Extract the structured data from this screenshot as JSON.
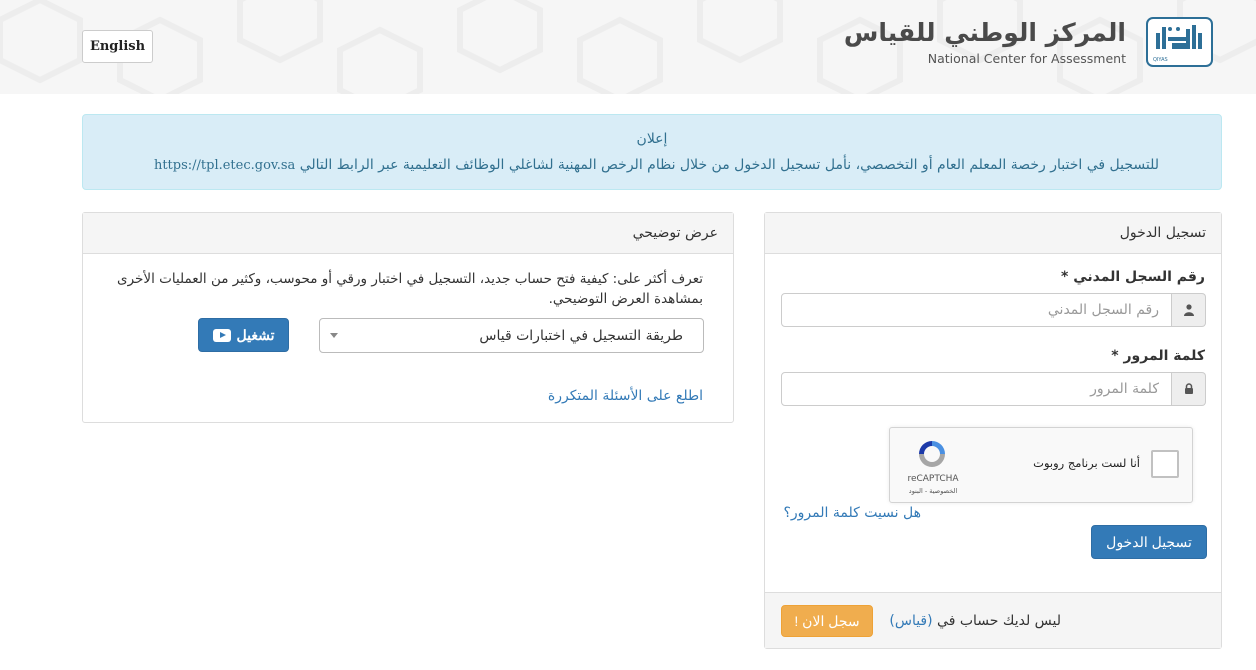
{
  "header": {
    "language_button": "English",
    "org_name_ar": "المركز الوطني للقياس",
    "org_name_en": "National Center for Assessment",
    "logo_caption": "QIYAS",
    "logo_icon": "qiyas-logo-icon"
  },
  "announcement": {
    "title": "إعلان",
    "body": "للتسجيل في اختبار رخصة المعلم العام أو التخصصي، نأمل تسجيل الدخول من خلال نظام الرخص المهنية لشاغلي الوظائف التعليمية عبر الرابط التالي",
    "url": "https://tpl.etec.gov.sa"
  },
  "demo": {
    "heading": "عرض توضيحي",
    "description": "تعرف أكثر على: كيفية فتح حساب جديد، التسجيل في اختبار ورقي أو محوسب، وكثير من العمليات الأخرى بمشاهدة العرض التوضيحي.",
    "selected_video": "طريقة التسجيل في اختبارات قياس",
    "play_label": "تشغيل",
    "faq_link": "اطلع على الأسئلة المتكررة"
  },
  "login": {
    "heading": "تسجيل الدخول",
    "id_label": "رقم السجل المدني *",
    "id_placeholder": "رقم السجل المدني",
    "password_label": "كلمة المرور *",
    "password_placeholder": "كلمة المرور",
    "captcha_label": "أنا لست برنامج روبوت",
    "captcha_brand": "reCAPTCHA",
    "captcha_terms": "الخصوصية - البنود",
    "forgot_link": "هل نسيت كلمة المرور؟",
    "submit_label": "تسجيل الدخول",
    "no_account_text": "ليس لديك حساب في",
    "no_account_brand": "(قياس)",
    "register_label": "سجل الان !"
  },
  "colors": {
    "primary": "#337ab7",
    "warning": "#f0ad4e",
    "info_bg": "#d9edf7",
    "info_text": "#31708f",
    "logo_blue": "#2d6f97"
  }
}
